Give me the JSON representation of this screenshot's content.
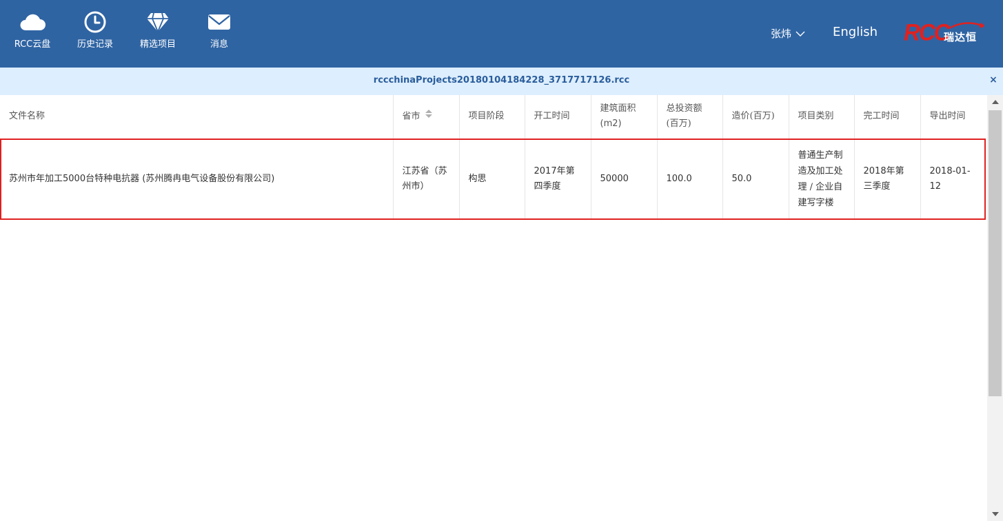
{
  "nav": {
    "items": [
      {
        "icon": "cloud-icon",
        "label": "RCC云盘"
      },
      {
        "icon": "clock-icon",
        "label": "历史记录"
      },
      {
        "icon": "diamond-icon",
        "label": "精选项目"
      },
      {
        "icon": "envelope-icon",
        "label": "消息"
      }
    ],
    "user_name": "张炜",
    "language_link": "English",
    "logo": {
      "mark": "RCC",
      "cn": "瑞达恒"
    }
  },
  "file_bar": {
    "filename": "rccchinaProjects20180104184228_3717717126.rcc",
    "close_label": "×"
  },
  "table": {
    "headers": [
      "文件名称",
      "省市",
      "项目阶段",
      "开工时间",
      "建筑面积(m2)",
      "总投资额(百万)",
      "造价(百万)",
      "项目类别",
      "完工时间",
      "导出时间"
    ],
    "rows": [
      {
        "name": "苏州市年加工5000台特种电抗器 (苏州腾冉电气设备股份有限公司)",
        "province": "江苏省（苏州市）",
        "stage": "构思",
        "start": "2017年第四季度",
        "area": "50000",
        "investment": "100.0",
        "cost": "50.0",
        "category": "普通生产制造及加工处理 / 企业自建写字楼",
        "complete": "2018年第三季度",
        "export": "2018-01-12"
      }
    ]
  },
  "colors": {
    "topbar": "#2f64a3",
    "filebar": "#ddeeff",
    "filename_text": "#2a5d9b",
    "selection_border": "#e02020",
    "logo_red": "#e0211f"
  }
}
